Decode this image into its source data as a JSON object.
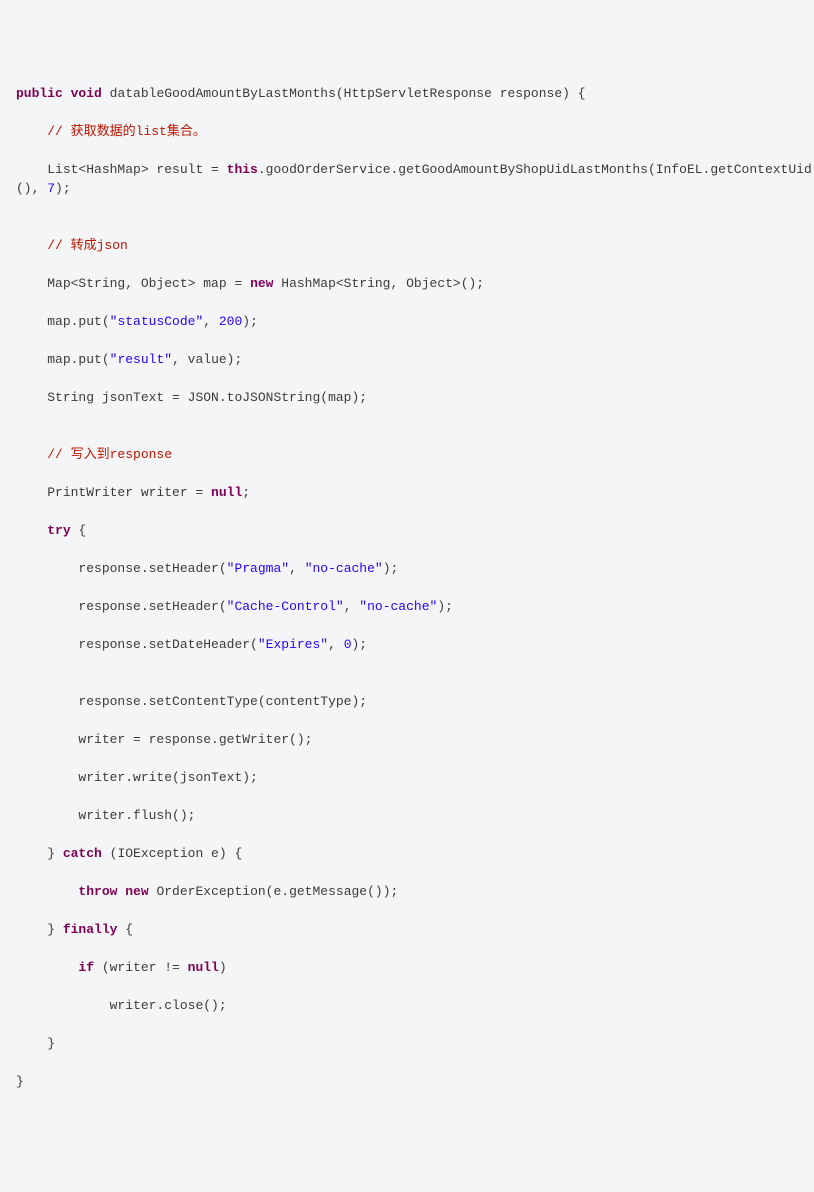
{
  "code": {
    "l1": {
      "a": "public",
      "b": " ",
      "c": "void",
      "d": " datableGoodAmountByLastMonths(HttpServletResponse response) {"
    },
    "l2": {
      "a": "    // 获取数据的list集合。"
    },
    "l3": {
      "a": "    List<HashMap> result = ",
      "b": "this",
      "c": ".goodOrderService.getGoodAmountByShopUidLastMonths(InfoEL.getContextUid(), ",
      "d": "7",
      "e": ");"
    },
    "l4": "",
    "l5": {
      "a": "    // 转成json"
    },
    "l6": {
      "a": "    Map<String, Object> map = ",
      "b": "new",
      "c": " HashMap<String, Object>();"
    },
    "l7": {
      "a": "    map.put(",
      "b": "\"statusCode\"",
      "c": ", ",
      "d": "200",
      "e": ");"
    },
    "l8": {
      "a": "    map.put(",
      "b": "\"result\"",
      "c": ", value);"
    },
    "l9": {
      "a": "    String jsonText = JSON.toJSONString(map);"
    },
    "l10": "",
    "l11": {
      "a": "    // 写入到response"
    },
    "l12": {
      "a": "    PrintWriter writer = ",
      "b": "null",
      "c": ";"
    },
    "l13": {
      "a": "    ",
      "b": "try",
      "c": " {"
    },
    "l14": {
      "a": "        response.setHeader(",
      "b": "\"Pragma\"",
      "c": ", ",
      "d": "\"no-cache\"",
      "e": ");"
    },
    "l15": {
      "a": "        response.setHeader(",
      "b": "\"Cache-Control\"",
      "c": ", ",
      "d": "\"no-cache\"",
      "e": ");"
    },
    "l16": {
      "a": "        response.setDateHeader(",
      "b": "\"Expires\"",
      "c": ", ",
      "d": "0",
      "e": ");"
    },
    "l17": "",
    "l18": {
      "a": "        response.setContentType(contentType);"
    },
    "l19": {
      "a": "        writer = response.getWriter();"
    },
    "l20": {
      "a": "        writer.write(jsonText);"
    },
    "l21": {
      "a": "        writer.flush();"
    },
    "l22": {
      "a": "    } ",
      "b": "catch",
      "c": " (IOException e) {"
    },
    "l23": {
      "a": "        ",
      "b": "throw",
      "c": " ",
      "d": "new",
      "e": " OrderException(e.getMessage());"
    },
    "l24": {
      "a": "    } ",
      "b": "finally",
      "c": " {"
    },
    "l25": {
      "a": "        ",
      "b": "if",
      "c": " (writer != ",
      "d": "null",
      "e": ")"
    },
    "l26": {
      "a": "            writer.close();"
    },
    "l27": {
      "a": "    }"
    },
    "l28": {
      "a": "}"
    }
  }
}
